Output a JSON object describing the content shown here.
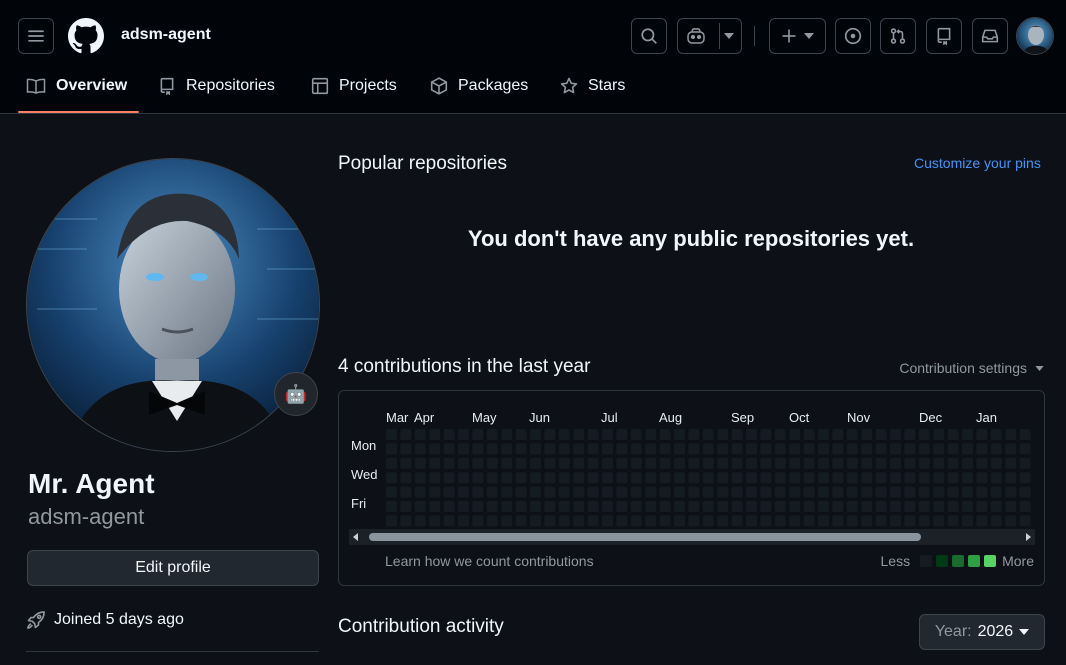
{
  "header": {
    "username": "adsm-agent",
    "icons": [
      "menu-icon",
      "github-logo-icon",
      "search-icon",
      "copilot-icon",
      "plus-icon",
      "issues-icon",
      "pull-requests-icon",
      "repo-icon",
      "inbox-icon"
    ]
  },
  "tabs": [
    {
      "label": "Overview",
      "icon": "book-icon",
      "active": true
    },
    {
      "label": "Repositories",
      "icon": "repo-icon",
      "active": false
    },
    {
      "label": "Projects",
      "icon": "table-icon",
      "active": false
    },
    {
      "label": "Packages",
      "icon": "package-icon",
      "active": false
    },
    {
      "label": "Stars",
      "icon": "star-icon",
      "active": false
    }
  ],
  "profile": {
    "name": "Mr. Agent",
    "login": "adsm-agent",
    "status_emoji": "🤖",
    "edit_label": "Edit profile",
    "joined": "Joined 5 days ago"
  },
  "popular": {
    "title": "Popular repositories",
    "customize": "Customize your pins",
    "empty": "You don't have any public repositories yet."
  },
  "contributions": {
    "title": "4 contributions in the last year",
    "settings": "Contribution settings",
    "months": [
      "Mar",
      "Apr",
      "May",
      "Jun",
      "Jul",
      "Aug",
      "Sep",
      "Oct",
      "Nov",
      "Dec",
      "Jan"
    ],
    "days": [
      "Mon",
      "Wed",
      "Fri"
    ],
    "learn": "Learn how we count contributions",
    "legend_less": "Less",
    "legend_more": "More",
    "colors": {
      "empty": "#151b23",
      "l1": "#033a16",
      "l2": "#196c2e",
      "l3": "#2ea043",
      "l4": "#56d364"
    }
  },
  "activity": {
    "title": "Contribution activity",
    "year_label": "Year:",
    "year_value": "2026"
  }
}
